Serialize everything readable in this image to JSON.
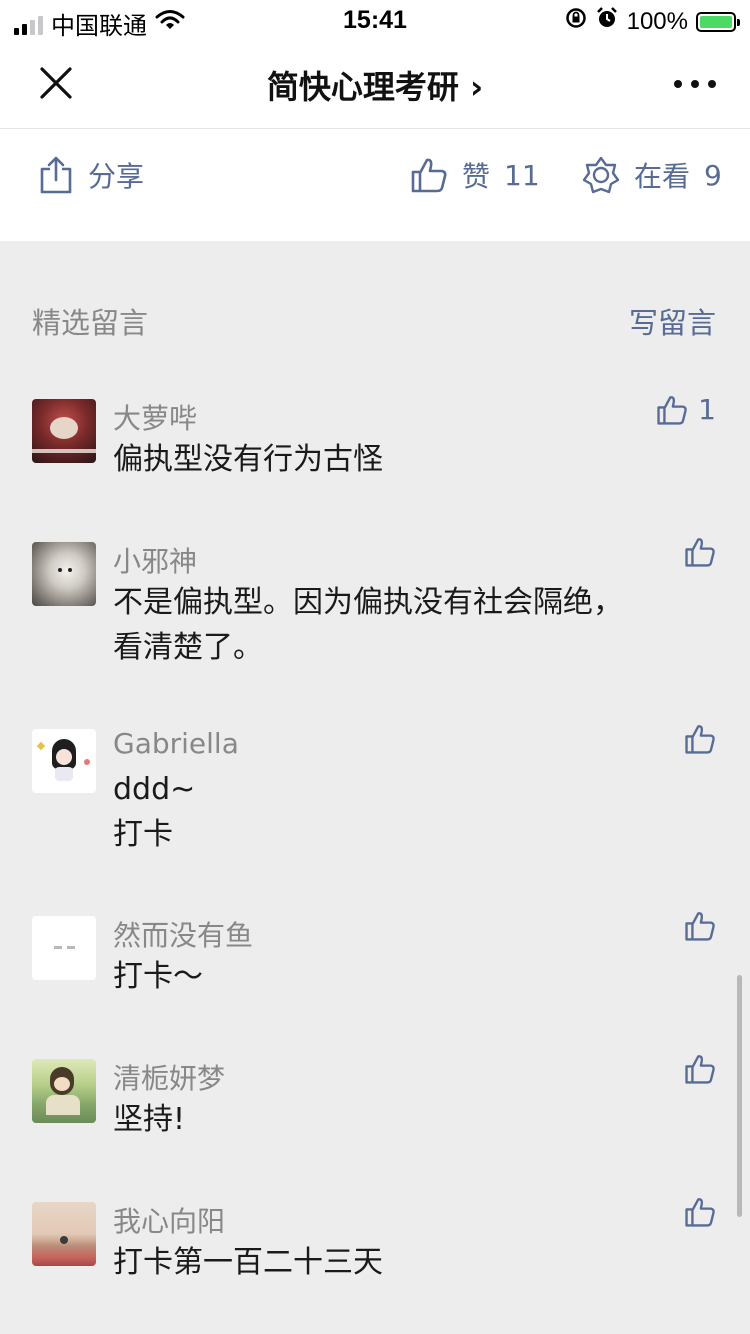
{
  "status_bar": {
    "carrier": "中国联通",
    "time": "15:41",
    "battery": "100%",
    "battery_level": 1.0
  },
  "nav": {
    "title": "简快心理考研",
    "title_suffix": "›"
  },
  "actions": {
    "share_label": "分享",
    "like_label": "赞",
    "like_count": "11",
    "wow_label": "在看",
    "wow_count": "9"
  },
  "comments_section": {
    "title": "精选留言",
    "write_label": "写留言",
    "items": [
      {
        "name": "大萝哔",
        "lines": [
          "偏执型没有行为古怪"
        ],
        "likes": "1"
      },
      {
        "name": "小邪神",
        "lines": [
          "不是偏执型。因为偏执没有社会隔绝，",
          "看清楚了。"
        ],
        "likes": ""
      },
      {
        "name": "Gabriella",
        "lines": [
          "ddd~",
          "打卡"
        ],
        "likes": ""
      },
      {
        "name": "然而没有鱼",
        "lines": [
          "打卡～"
        ],
        "likes": ""
      },
      {
        "name": "清栀妍梦",
        "lines": [
          "坚持!"
        ],
        "likes": ""
      },
      {
        "name": "我心向阳",
        "lines": [
          "打卡第一百二十三天"
        ],
        "likes": ""
      }
    ]
  },
  "colors": {
    "link_blue": "#576b95",
    "background": "#ededed"
  }
}
